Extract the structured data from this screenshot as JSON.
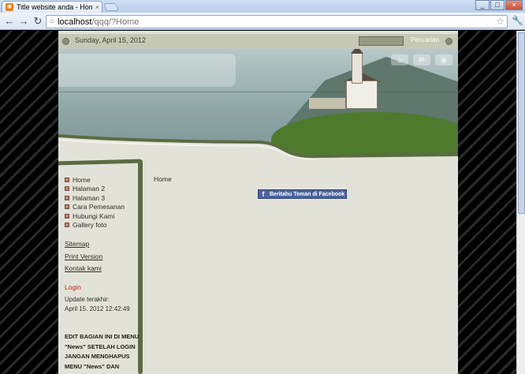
{
  "browser": {
    "tab_title": "Title website anda - Home",
    "tab_close": "×",
    "favicon": "rss-icon",
    "url_host": "localhost",
    "url_path": "/qqq/?Home",
    "controls": {
      "minimize": "_",
      "maximize": "□",
      "close": "×"
    },
    "nav": {
      "back": "←",
      "forward": "→",
      "reload": "↻"
    },
    "star_icon": "☆",
    "wrench_icon": "🔧"
  },
  "site": {
    "date": "Sunday, April 15, 2012",
    "search_label": "Pencarian",
    "header_buttons": [
      "⌂",
      "✉",
      "⊕"
    ],
    "menu": [
      {
        "label": "Home"
      },
      {
        "label": "Halaman 2"
      },
      {
        "label": "Halaman 3"
      },
      {
        "label": "Cara Pemesanan"
      },
      {
        "label": "Hubungi Kami"
      },
      {
        "label": "Gallery foto"
      }
    ],
    "links": {
      "sitemap": "Sitemap",
      "print": "Print Version",
      "contact": "Kontak kami"
    },
    "login": "Login",
    "update_label": "Update terakhir:",
    "update_value": "April 15. 2012 12:42:49",
    "edit_notice": "EDIT BAGIAN INI DI MENU \"News\" SETELAH LOGIN JANGAN MENGHAPUS MENU \"News\" DAN",
    "breadcrumb": "Home",
    "facebook_button": "Beritahu Teman di Facebook"
  },
  "colors": {
    "page_bg": "#e3e2d9",
    "accent_green": "#5b6b42",
    "login_red": "#c0201a",
    "facebook_blue": "#4a63a0"
  }
}
